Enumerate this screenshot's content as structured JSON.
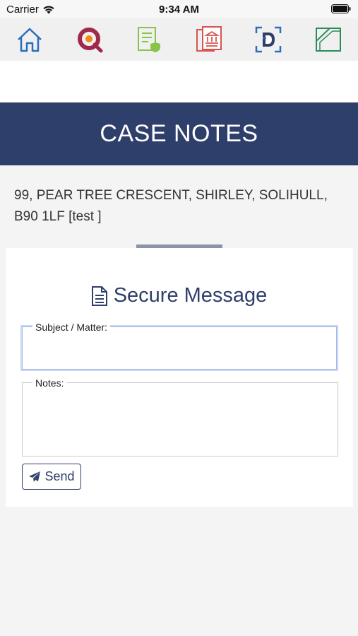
{
  "status_bar": {
    "carrier": "Carrier",
    "time": "9:34 AM"
  },
  "toolbar": {
    "icons": [
      "home-icon",
      "search-logo-icon",
      "document-shield-icon",
      "bank-document-icon",
      "scan-id-icon",
      "folder-icon"
    ],
    "colors": {
      "home": "#2a6ebb",
      "search_ring": "#a0284a",
      "search_dot": "#f08a1c",
      "document_shield": "#8bc34a",
      "bank_document": "#d9534f",
      "scan": "#2a6ebb",
      "folder": "#2e8b57"
    }
  },
  "header": {
    "title": "CASE NOTES",
    "background": "#2f3f6b"
  },
  "case": {
    "address": "99, PEAR TREE CRESCENT, SHIRLEY, SOLIHULL, B90 1LF [test ]"
  },
  "form": {
    "title": "Secure Message",
    "title_icon": "file-text-icon",
    "subject_label": "Subject / Matter:",
    "subject_value": "",
    "notes_label": "Notes:",
    "notes_value": "",
    "send_label": "Send",
    "send_icon": "paper-plane-icon"
  }
}
